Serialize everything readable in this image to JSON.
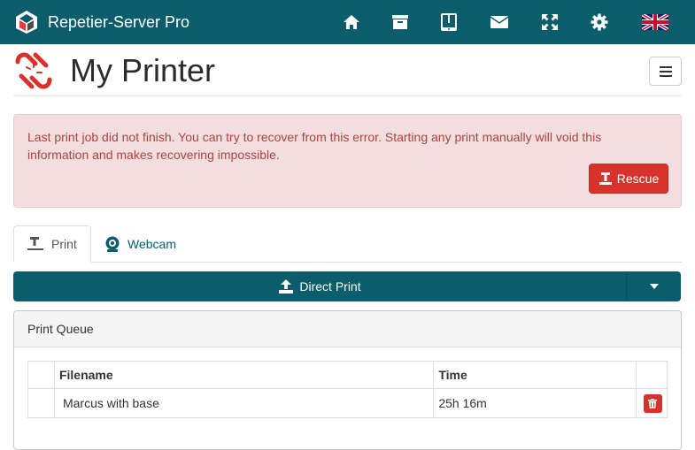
{
  "navbar": {
    "brand_name": "Repetier-Server Pro",
    "icons": [
      "home-icon",
      "archive-icon",
      "tablet-icon",
      "envelope-icon",
      "fullscreen-icon",
      "gear-icon",
      "uk-flag-icon"
    ]
  },
  "header": {
    "title": "My Printer",
    "menu_icon": "hamburger-icon"
  },
  "alert": {
    "message": "Last print job did not finish. You can try to recover from this error. Starting any print manually will void this information and makes recovering impossible.",
    "rescue_label": "Rescue"
  },
  "tabs": [
    {
      "label": "Print",
      "icon": "printer-icon",
      "active": true
    },
    {
      "label": "Webcam",
      "icon": "webcam-icon",
      "active": false
    }
  ],
  "direct_print": {
    "label": "Direct Print",
    "icon": "upload-icon"
  },
  "print_queue": {
    "title": "Print Queue",
    "columns": [
      "",
      "Filename",
      "Time",
      ""
    ],
    "rows": [
      {
        "filename": "Marcus with base",
        "time": "25h 16m"
      }
    ]
  },
  "colors": {
    "primary": "#0c5d6c",
    "danger": "#d9322c",
    "alert_bg": "#f2dede",
    "alert_text": "#a94442"
  }
}
